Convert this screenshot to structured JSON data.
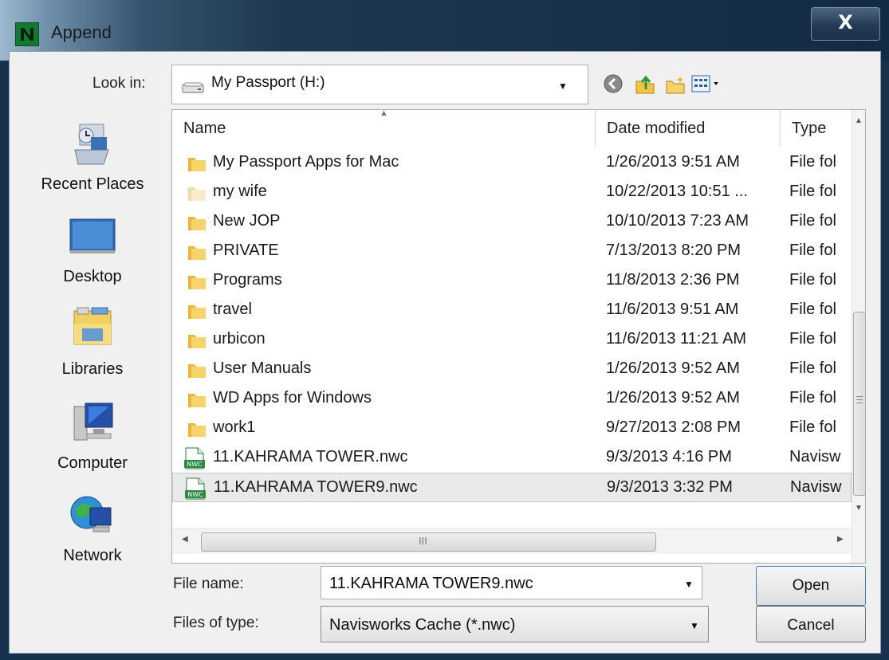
{
  "window": {
    "title": "Append",
    "close_label": "X"
  },
  "lookin": {
    "label": "Look in:",
    "value": "My Passport (H:)"
  },
  "toolbar": {
    "icons": [
      "back-icon",
      "up-folder-icon",
      "new-folder-icon",
      "view-menu-icon"
    ]
  },
  "places": [
    {
      "label": "Recent Places",
      "icon": "recent-places-icon"
    },
    {
      "label": "Desktop",
      "icon": "desktop-icon"
    },
    {
      "label": "Libraries",
      "icon": "libraries-icon"
    },
    {
      "label": "Computer",
      "icon": "computer-icon"
    },
    {
      "label": "Network",
      "icon": "network-icon"
    }
  ],
  "columns": {
    "name": "Name",
    "date": "Date modified",
    "type": "Type"
  },
  "files": [
    {
      "name": "My Passport Apps for Mac",
      "date": "1/26/2013 9:51 AM",
      "type": "File fol",
      "icon": "folder-icon"
    },
    {
      "name": "my wife",
      "date": "10/22/2013 10:51 ...",
      "type": "File fol",
      "icon": "folder-icon"
    },
    {
      "name": "New JOP",
      "date": "10/10/2013 7:23 AM",
      "type": "File fol",
      "icon": "folder-icon"
    },
    {
      "name": "PRIVATE",
      "date": "7/13/2013 8:20 PM",
      "type": "File fol",
      "icon": "folder-icon"
    },
    {
      "name": "Programs",
      "date": "11/8/2013 2:36 PM",
      "type": "File fol",
      "icon": "folder-icon"
    },
    {
      "name": "travel",
      "date": "11/6/2013 9:51 AM",
      "type": "File fol",
      "icon": "folder-icon"
    },
    {
      "name": "urbicon",
      "date": "11/6/2013 11:21 AM",
      "type": "File fol",
      "icon": "folder-icon"
    },
    {
      "name": "User Manuals",
      "date": "1/26/2013 9:52 AM",
      "type": "File fol",
      "icon": "folder-icon"
    },
    {
      "name": "WD Apps for Windows",
      "date": "1/26/2013 9:52 AM",
      "type": "File fol",
      "icon": "folder-icon"
    },
    {
      "name": "work1",
      "date": "9/27/2013 2:08 PM",
      "type": "File fol",
      "icon": "folder-icon"
    },
    {
      "name": "11.KAHRAMA TOWER.nwc",
      "date": "9/3/2013 4:16 PM",
      "type": "Navisw",
      "icon": "nwc-file-icon"
    },
    {
      "name": "11.KAHRAMA TOWER9.nwc",
      "date": "9/3/2013 3:32 PM",
      "type": "Navisw",
      "icon": "nwc-file-icon",
      "selected": true
    }
  ],
  "hscroll_grip": "III",
  "filename": {
    "label": "File name:",
    "value": "11.KAHRAMA TOWER9.nwc"
  },
  "filetype": {
    "label": "Files of type:",
    "value": "Navisworks Cache (*.nwc)"
  },
  "buttons": {
    "open": "Open",
    "cancel": "Cancel"
  }
}
